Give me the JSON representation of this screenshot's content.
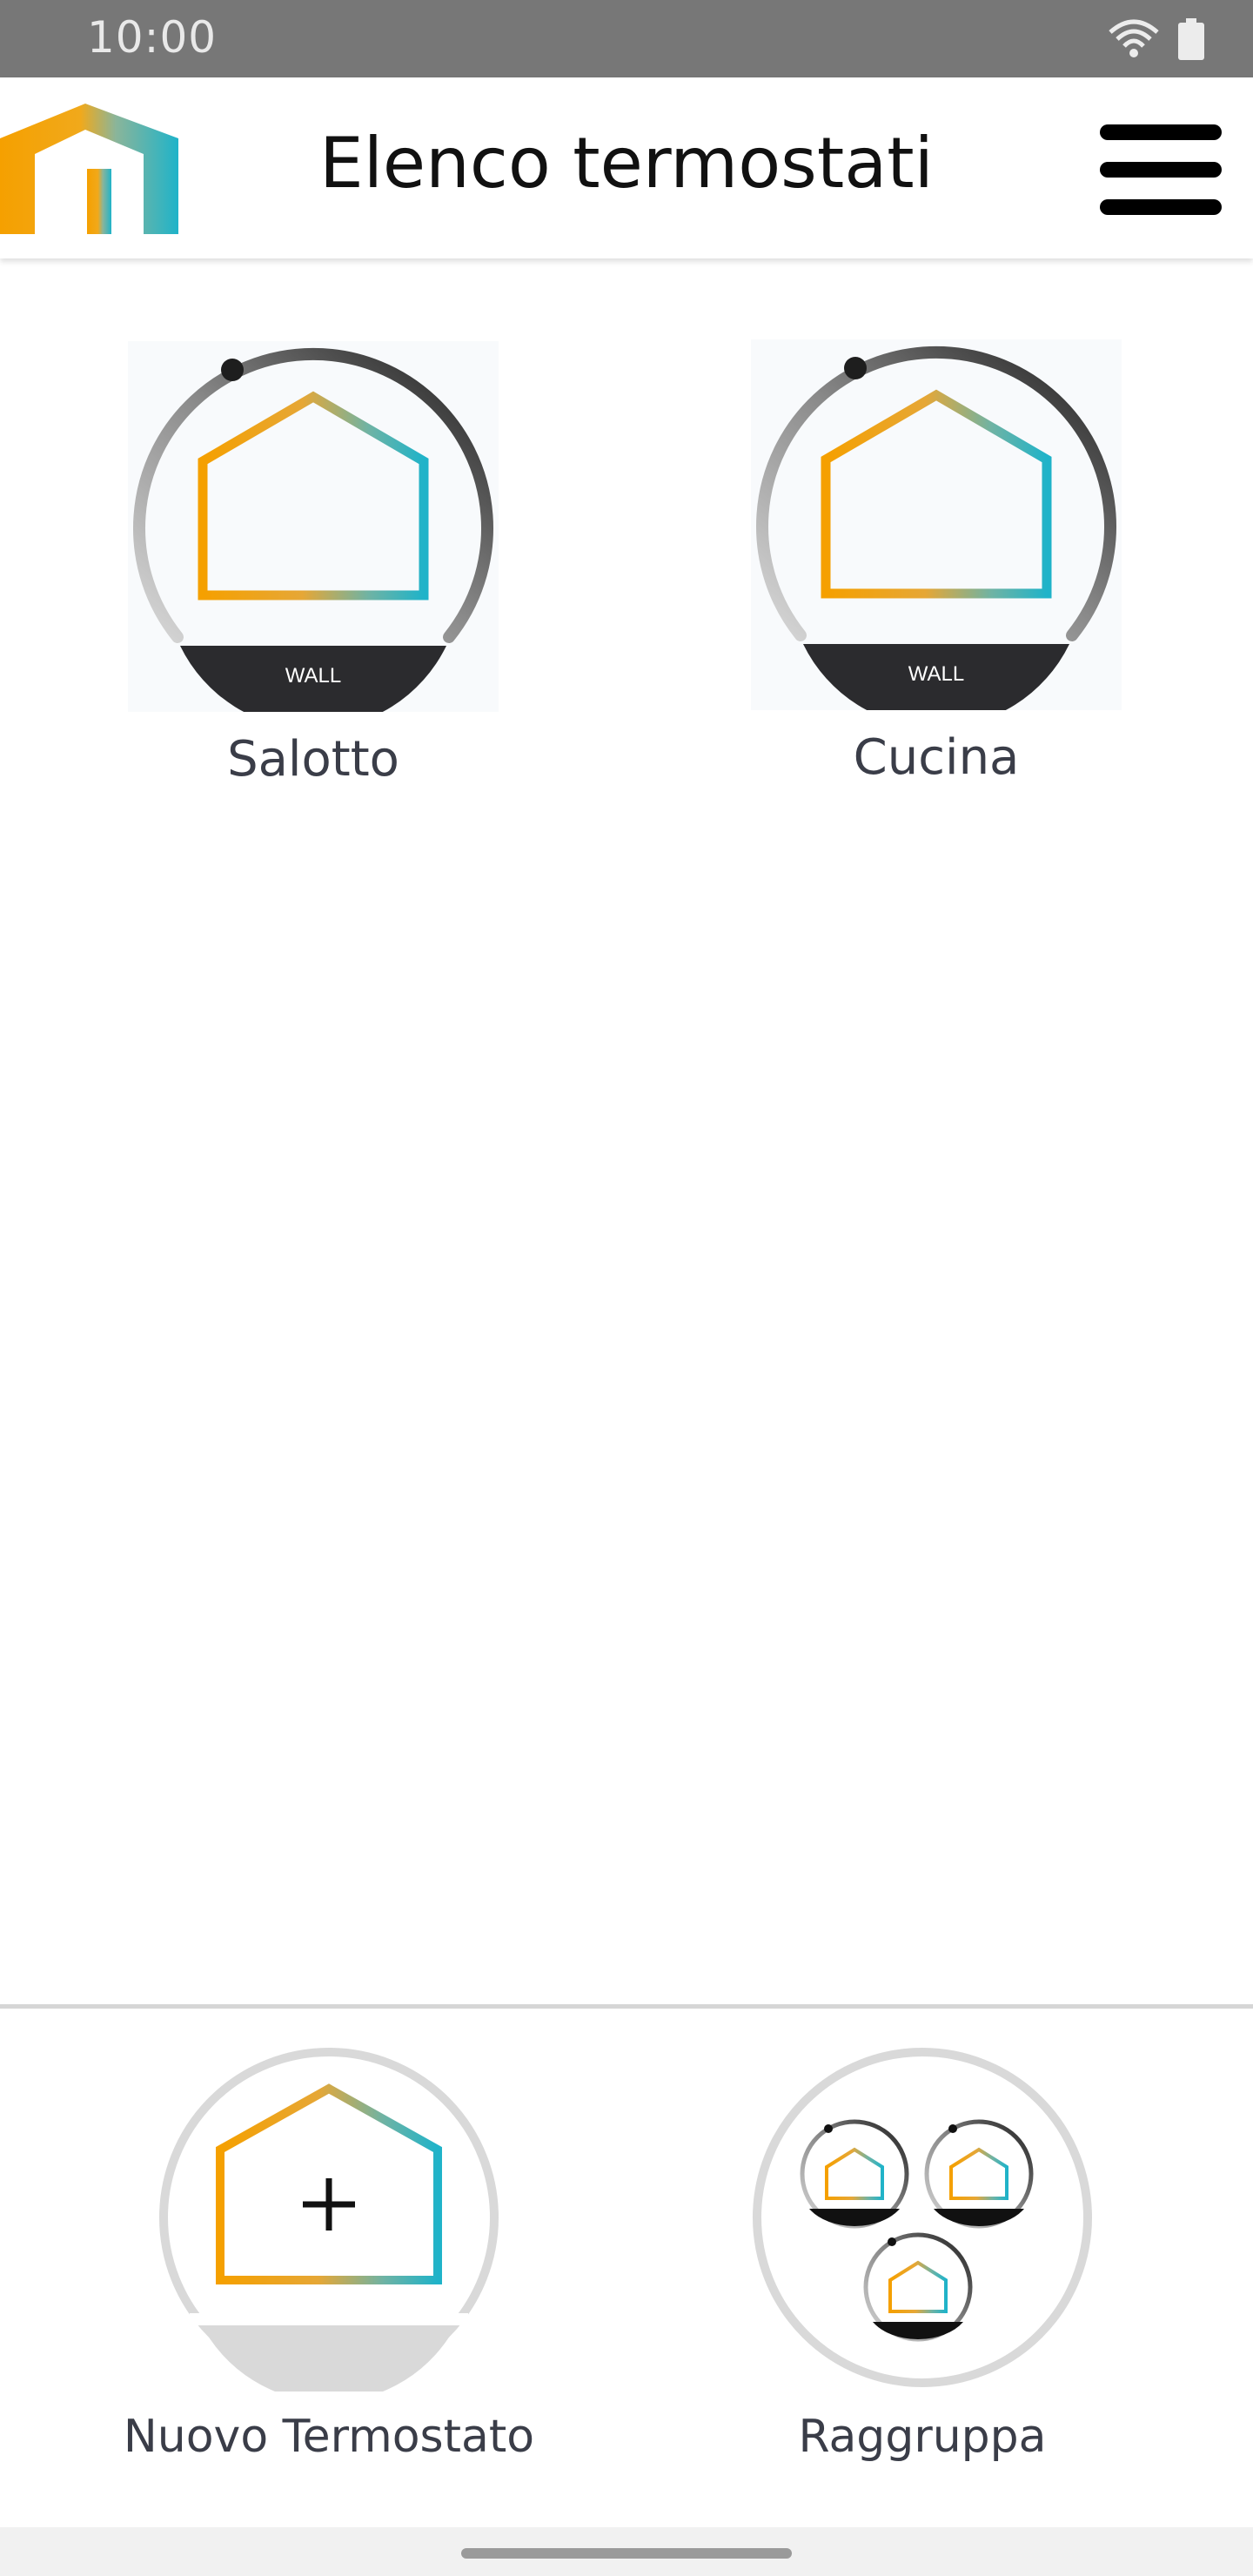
{
  "status_bar": {
    "time": "10:00",
    "icons": [
      "wifi-icon",
      "battery-icon"
    ]
  },
  "header": {
    "title": "Elenco termostati",
    "logo_icon": "house-logo-icon",
    "menu_icon": "hamburger-menu-icon"
  },
  "thermostats": [
    {
      "name": "Salotto",
      "badge": "WALL"
    },
    {
      "name": "Cucina",
      "badge": "WALL"
    }
  ],
  "actions": {
    "new_thermostat_label": "Nuovo Termostato",
    "group_label": "Raggruppa"
  },
  "colors": {
    "orange": "#f5a000",
    "teal": "#1fb3c9",
    "dark": "#2b2b2e",
    "status_bar": "#777777"
  }
}
